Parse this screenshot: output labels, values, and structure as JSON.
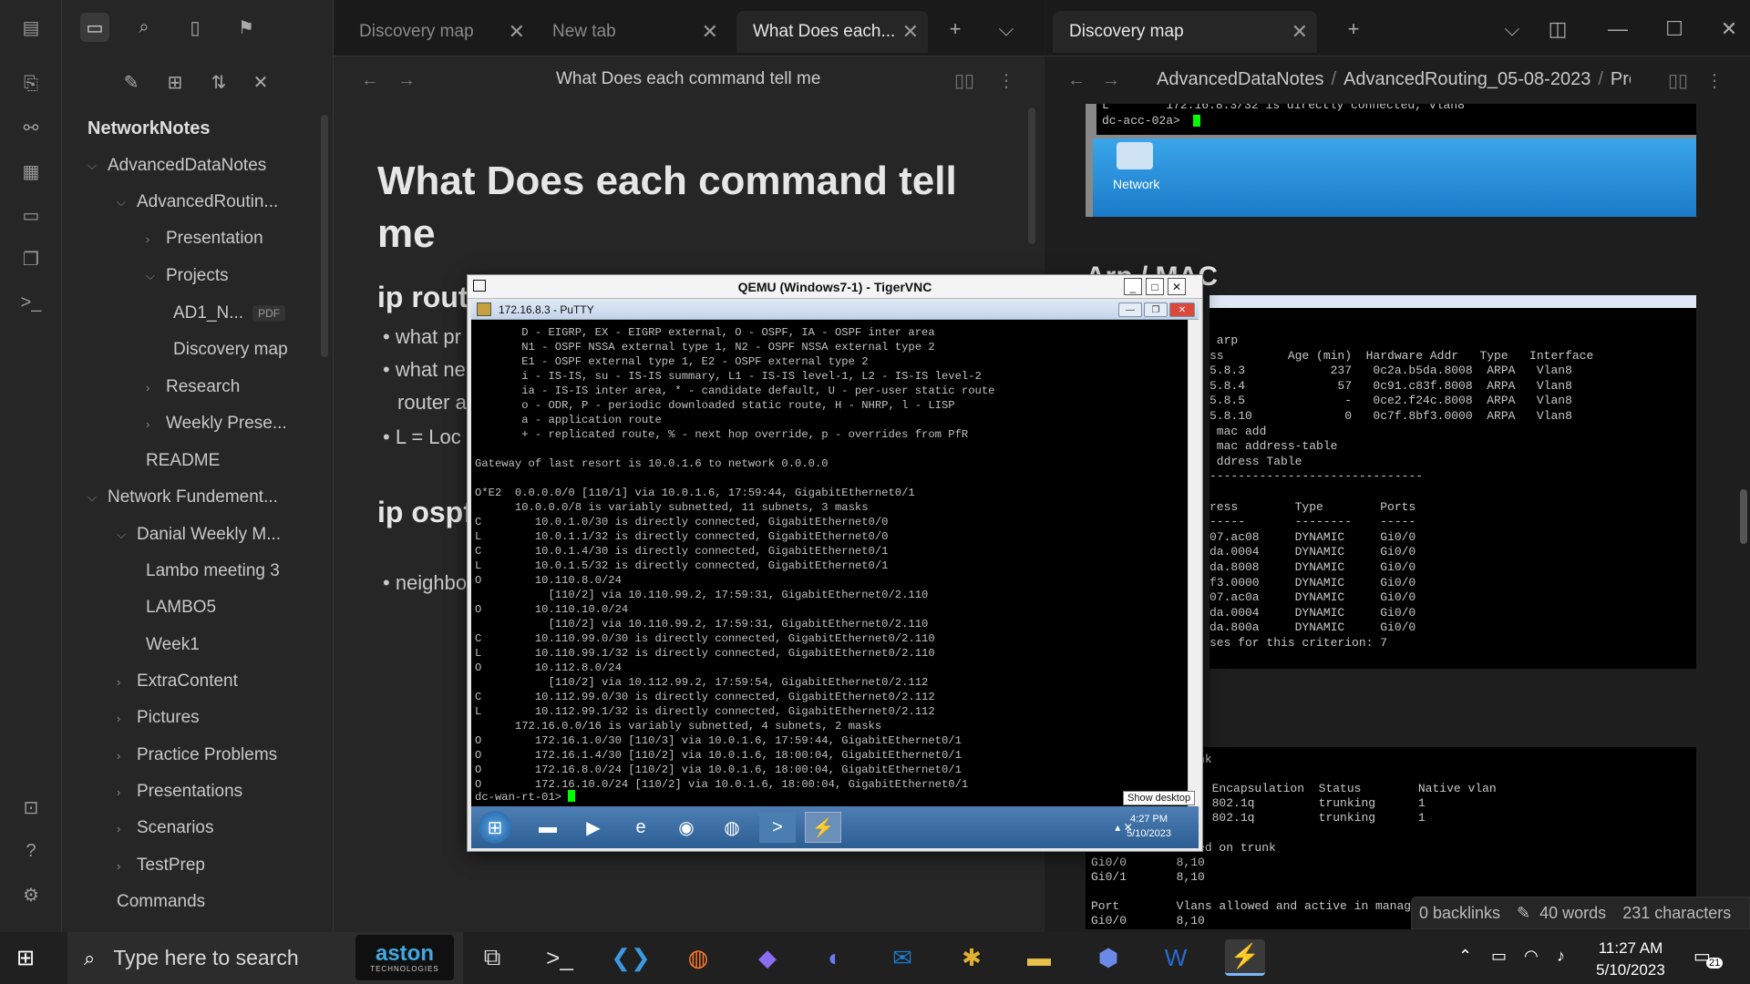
{
  "left_tabs": [
    {
      "label": "Discovery map"
    },
    {
      "label": "New tab"
    },
    {
      "label": "What Does each..."
    }
  ],
  "right_tab": {
    "label": "Discovery map"
  },
  "sidebar": {
    "vault": "NetworkNotes",
    "items": [
      {
        "label": "AdvancedDataNotes"
      },
      {
        "label": "AdvancedRoutin..."
      },
      {
        "label": "Presentation"
      },
      {
        "label": "Projects"
      },
      {
        "label": "AD1_N..."
      },
      {
        "label": "Discovery map"
      },
      {
        "label": "Research"
      },
      {
        "label": "Weekly Prese..."
      },
      {
        "label": "README"
      },
      {
        "label": "Network Fundement..."
      },
      {
        "label": "Danial Weekly M..."
      },
      {
        "label": "Lambo meeting 3"
      },
      {
        "label": "LAMBO5"
      },
      {
        "label": "Week1"
      },
      {
        "label": "ExtraContent"
      },
      {
        "label": "Pictures"
      },
      {
        "label": "Practice Problems"
      },
      {
        "label": "Presentations"
      },
      {
        "label": "Scenarios"
      },
      {
        "label": "TestPrep"
      },
      {
        "label": "Commands"
      }
    ],
    "pdf_badge": "PDF"
  },
  "editor": {
    "nav_title": "What Does each command tell me",
    "heading": "What Does each command tell me",
    "h2_1": "ip rout",
    "b1": "• what pr",
    "b2": "• what ne",
    "b2b": "router a",
    "b3": "• L = Loc",
    "h2_2": "ip ospf",
    "b4": "• neighbo"
  },
  "right_pane": {
    "breadcrumb": [
      "AdvancedDataNotes",
      "AdvancedRouting_05-08-2023",
      "Proje"
    ],
    "arp_heading": "Arp / MAC",
    "top_term": "L        172.16.8.3/32 is directly connected, Vlan8\ndc-acc-02a>",
    "network_label": "Network",
    "arp_term": " arp\nss         Age (min)  Hardware Addr   Type   Interface\n5.8.3            237   0c2a.b5da.8008  ARPA   Vlan8\n5.8.4             57   0c91.c83f.8008  ARPA   Vlan8\n5.8.5              -   0ce2.f24c.8008  ARPA   Vlan8\n5.8.10             0   0c7f.8bf3.0000  ARPA   Vlan8\n mac add\n mac address-table\n ddress Table\n------------------------------\n\nress        Type        Ports\n-----       --------    -----\n07.ac08     DYNAMIC     Gi0/0\nda.0004     DYNAMIC     Gi0/0\nda.8008     DYNAMIC     Gi0/0\nf3.0000     DYNAMIC     Gi0/0\n07.ac0a     DYNAMIC     Gi0/0\nda.0004     DYNAMIC     Gi0/0\nda.800a     DYNAMIC     Gi0/0\nses for this criterion: 7",
    "trunk_term": "        int trunk\n\n                 Encapsulation  Status        Native vlan\n                 802.1q         trunking      1\n                 802.1q         trunking      1\n\n        s allowed on trunk\nGi0/0       8,10\nGi0/1       8,10\n\nPort        Vlans allowed and active in manag\nGi0/0       8,10"
  },
  "vnc": {
    "title": "QEMU (Windows7-1) - TigerVNC",
    "putty_title": "172.16.8.3 - PuTTY",
    "terminal": "       D - EIGRP, EX - EIGRP external, O - OSPF, IA - OSPF inter area\n       N1 - OSPF NSSA external type 1, N2 - OSPF NSSA external type 2\n       E1 - OSPF external type 1, E2 - OSPF external type 2\n       i - IS-IS, su - IS-IS summary, L1 - IS-IS level-1, L2 - IS-IS level-2\n       ia - IS-IS inter area, * - candidate default, U - per-user static route\n       o - ODR, P - periodic downloaded static route, H - NHRP, l - LISP\n       a - application route\n       + - replicated route, % - next hop override, p - overrides from PfR\n\nGateway of last resort is 10.0.1.6 to network 0.0.0.0\n\nO*E2  0.0.0.0/0 [110/1] via 10.0.1.6, 17:59:44, GigabitEthernet0/1\n      10.0.0.0/8 is variably subnetted, 11 subnets, 3 masks\nC        10.0.1.0/30 is directly connected, GigabitEthernet0/0\nL        10.0.1.1/32 is directly connected, GigabitEthernet0/0\nC        10.0.1.4/30 is directly connected, GigabitEthernet0/1\nL        10.0.1.5/32 is directly connected, GigabitEthernet0/1\nO        10.110.8.0/24\n           [110/2] via 10.110.99.2, 17:59:31, GigabitEthernet0/2.110\nO        10.110.10.0/24\n           [110/2] via 10.110.99.2, 17:59:31, GigabitEthernet0/2.110\nC        10.110.99.0/30 is directly connected, GigabitEthernet0/2.110\nL        10.110.99.1/32 is directly connected, GigabitEthernet0/2.110\nO        10.112.8.0/24\n           [110/2] via 10.112.99.2, 17:59:54, GigabitEthernet0/2.112\nC        10.112.99.0/30 is directly connected, GigabitEthernet0/2.112\nL        10.112.99.1/32 is directly connected, GigabitEthernet0/2.112\n      172.16.0.0/16 is variably subnetted, 4 subnets, 2 masks\nO        172.16.1.0/30 [110/3] via 10.0.1.6, 17:59:44, GigabitEthernet0/1\nO        172.16.1.4/30 [110/2] via 10.0.1.6, 18:00:04, GigabitEthernet0/1\nO        172.16.8.0/24 [110/2] via 10.0.1.6, 18:00:04, GigabitEthernet0/1\nO        172.16.10.0/24 [110/2] via 10.0.1.6, 18:00:04, GigabitEthernet0/1\n",
    "prompt": "dc-wan-rt-01>",
    "show_desktop": "Show desktop",
    "clock_time": "4:27 PM",
    "clock_date": "5/10/2023"
  },
  "status": {
    "backlinks": "0 backlinks",
    "words": "40 words",
    "characters": "231 characters"
  },
  "taskbar": {
    "search_placeholder": "Type here to search",
    "aston_logo": "aston",
    "aston_sub": "TECHNOLOGIES",
    "time": "11:27 AM",
    "date": "5/10/2023",
    "notifications": "21"
  }
}
